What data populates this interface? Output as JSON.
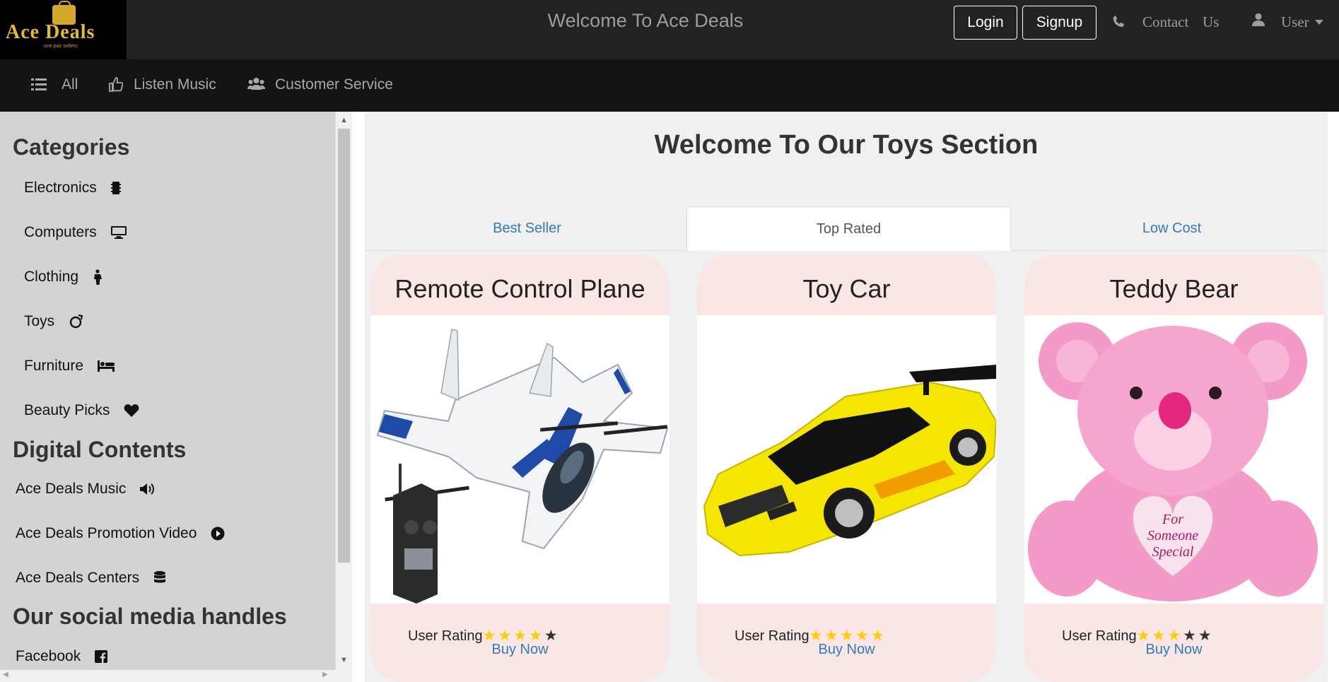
{
  "brand": {
    "name": "Ace Deals",
    "tagline": "one pair sellers"
  },
  "header": {
    "title": "Welcome To Ace Deals",
    "login_label": "Login",
    "signup_label": "Signup",
    "contact_label": "Contact",
    "us_label": "Us",
    "user_label": "User"
  },
  "nav": {
    "items": [
      {
        "label": "All",
        "icon": "list-icon"
      },
      {
        "label": "Listen Music",
        "icon": "thumbs-up-icon"
      },
      {
        "label": "Customer Service",
        "icon": "users-icon"
      }
    ]
  },
  "sidebar": {
    "categories_heading": "Categories",
    "categories": [
      {
        "label": "Electronics",
        "icon": "chip-icon"
      },
      {
        "label": "Computers",
        "icon": "monitor-icon"
      },
      {
        "label": "Clothing",
        "icon": "person-icon"
      },
      {
        "label": "Toys",
        "icon": "ring-icon"
      },
      {
        "label": "Furniture",
        "icon": "bed-icon"
      },
      {
        "label": "Beauty Picks",
        "icon": "heart-icon"
      }
    ],
    "digital_heading": "Digital Contents",
    "digital": [
      {
        "label": "Ace Deals Music",
        "icon": "volume-icon"
      },
      {
        "label": "Ace Deals Promotion Video",
        "icon": "play-icon"
      },
      {
        "label": "Ace Deals Centers",
        "icon": "database-icon"
      }
    ],
    "social_heading": "Our social media handles",
    "social": [
      {
        "label": "Facebook",
        "icon": "facebook-icon"
      }
    ]
  },
  "main": {
    "title": "Welcome To Our Toys Section",
    "tabs": [
      {
        "label": "Best Seller",
        "active": false
      },
      {
        "label": "Top Rated",
        "active": true
      },
      {
        "label": "Low Cost",
        "active": false
      }
    ],
    "products": [
      {
        "name": "Remote Control Plane",
        "rating_label": "User Rating",
        "rating": 4,
        "rating_max": 5,
        "buy_label": "Buy Now",
        "image": "plane-image"
      },
      {
        "name": "Toy Car",
        "rating_label": "User Rating",
        "rating": 5,
        "rating_max": 5,
        "buy_label": "Buy Now",
        "image": "car-image"
      },
      {
        "name": "Teddy Bear",
        "rating_label": "User Rating",
        "rating": 3,
        "rating_max": 5,
        "buy_label": "Buy Now",
        "image": "teddy-image"
      }
    ]
  },
  "colors": {
    "topbar": "#222222",
    "navbar": "#141414",
    "sidebar": "#d3d3d3",
    "card": "#fbe6e6",
    "link": "#337ab7",
    "star": "#ffcc00",
    "brand_gold": "#e3b93a"
  }
}
